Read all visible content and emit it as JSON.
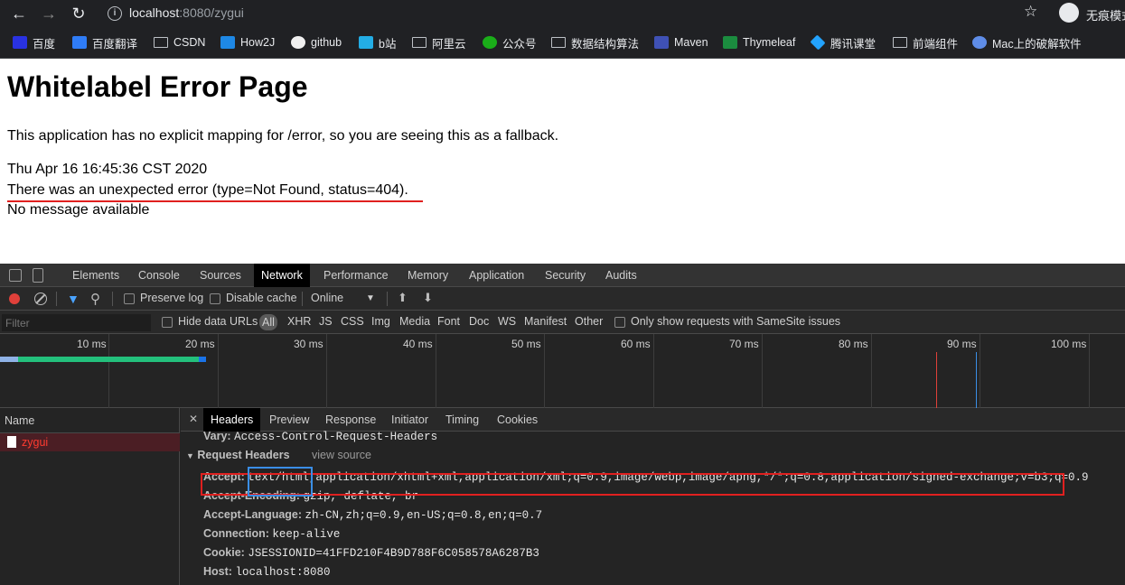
{
  "browser": {
    "url_host": "localhost",
    "url_rest": ":8080/zygui",
    "incognito_label": "无痕模式",
    "bookmarks": [
      {
        "label": "百度",
        "icon": "baidu-icon",
        "color": "#2932e1"
      },
      {
        "label": "百度翻译",
        "icon": "translate-icon",
        "color": "#2f7cf6"
      },
      {
        "label": "CSDN",
        "icon": "folder-icon",
        "color": ""
      },
      {
        "label": "How2J",
        "icon": "how2j-icon",
        "color": "#1e88e5"
      },
      {
        "label": "github",
        "icon": "github-icon",
        "color": "#f0f0f0"
      },
      {
        "label": "b站",
        "icon": "bilibili-icon",
        "color": "#23ade5"
      },
      {
        "label": "阿里云",
        "icon": "folder-icon",
        "color": ""
      },
      {
        "label": "公众号",
        "icon": "wechat-icon",
        "color": "#1aad19"
      },
      {
        "label": "数据结构算法",
        "icon": "folder-icon",
        "color": ""
      },
      {
        "label": "Maven",
        "icon": "maven-icon",
        "color": "#3f51b5"
      },
      {
        "label": "Thymeleaf",
        "icon": "thymeleaf-icon",
        "color": "#1b8c3f"
      },
      {
        "label": "腾讯课堂",
        "icon": "tencent-icon",
        "color": "#23a3ff"
      },
      {
        "label": "前端组件",
        "icon": "folder-icon",
        "color": ""
      },
      {
        "label": "Mac上的破解软件",
        "icon": "chrome-icon",
        "color": "#5f8de8"
      }
    ]
  },
  "page": {
    "title": "Whitelabel Error Page",
    "description": "This application has no explicit mapping for /error, so you are seeing this as a fallback.",
    "timestamp": "Thu Apr 16 16:45:36 CST 2020",
    "error_line": "There was an unexpected error (type=Not Found, status=404).",
    "message": "No message available"
  },
  "devtools": {
    "tabs": [
      "Elements",
      "Console",
      "Sources",
      "Network",
      "Performance",
      "Memory",
      "Application",
      "Security",
      "Audits"
    ],
    "active_tab": "Network",
    "toolbar": {
      "preserve_log": "Preserve log",
      "disable_cache": "Disable cache",
      "throttle": "Online"
    },
    "filter": {
      "placeholder": "Filter",
      "hide_data_urls": "Hide data URLs",
      "types": [
        "All",
        "XHR",
        "JS",
        "CSS",
        "Img",
        "Media",
        "Font",
        "Doc",
        "WS",
        "Manifest",
        "Other"
      ],
      "samesite": "Only show requests with SameSite issues"
    },
    "timeline_labels": [
      "10 ms",
      "20 ms",
      "30 ms",
      "40 ms",
      "50 ms",
      "60 ms",
      "70 ms",
      "80 ms",
      "90 ms",
      "100 ms"
    ],
    "name_header": "Name",
    "request_name": "zygui",
    "detail_tabs": [
      "Headers",
      "Preview",
      "Response",
      "Initiator",
      "Timing",
      "Cookies"
    ],
    "active_detail_tab": "Headers",
    "vary_key": "Vary:",
    "vary_value": "Access-Control-Request-Headers",
    "request_headers_title": "Request Headers",
    "view_source": "view source",
    "headers": [
      {
        "key": "Accept:",
        "value": "text/html,application/xhtml+xml,application/xml;q=0.9,image/webp,image/apng,*/*;q=0.8,application/signed-exchange;v=b3;q=0.9"
      },
      {
        "key": "Accept-Encoding:",
        "value": "gzip, deflate, br"
      },
      {
        "key": "Accept-Language:",
        "value": "zh-CN,zh;q=0.9,en-US;q=0.8,en;q=0.7"
      },
      {
        "key": "Connection:",
        "value": "keep-alive"
      },
      {
        "key": "Cookie:",
        "value": "JSESSIONID=41FFD210F4B9D788F6C058578A6287B3"
      },
      {
        "key": "Host:",
        "value": "localhost:8080"
      }
    ]
  }
}
